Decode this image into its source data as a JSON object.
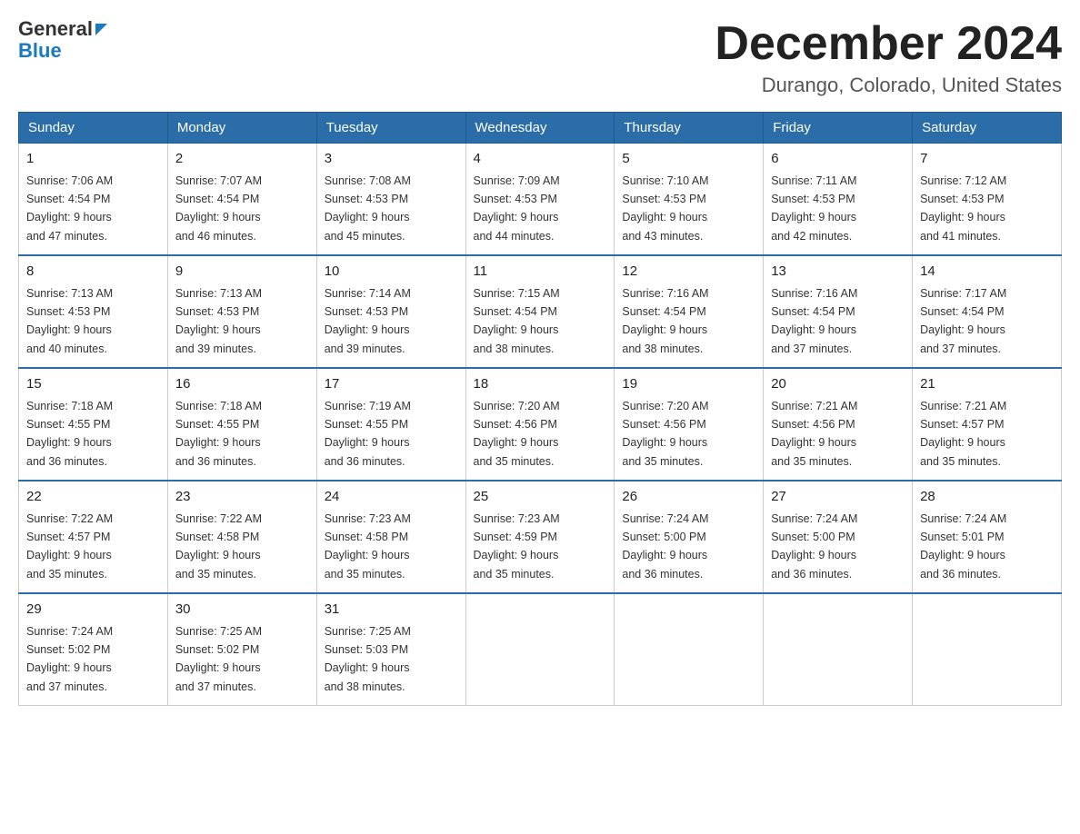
{
  "header": {
    "logo_general": "General",
    "logo_blue": "Blue",
    "month_title": "December 2024",
    "location": "Durango, Colorado, United States"
  },
  "days_of_week": [
    "Sunday",
    "Monday",
    "Tuesday",
    "Wednesday",
    "Thursday",
    "Friday",
    "Saturday"
  ],
  "weeks": [
    [
      {
        "day": "1",
        "sunrise": "7:06 AM",
        "sunset": "4:54 PM",
        "daylight": "9 hours and 47 minutes."
      },
      {
        "day": "2",
        "sunrise": "7:07 AM",
        "sunset": "4:54 PM",
        "daylight": "9 hours and 46 minutes."
      },
      {
        "day": "3",
        "sunrise": "7:08 AM",
        "sunset": "4:53 PM",
        "daylight": "9 hours and 45 minutes."
      },
      {
        "day": "4",
        "sunrise": "7:09 AM",
        "sunset": "4:53 PM",
        "daylight": "9 hours and 44 minutes."
      },
      {
        "day": "5",
        "sunrise": "7:10 AM",
        "sunset": "4:53 PM",
        "daylight": "9 hours and 43 minutes."
      },
      {
        "day": "6",
        "sunrise": "7:11 AM",
        "sunset": "4:53 PM",
        "daylight": "9 hours and 42 minutes."
      },
      {
        "day": "7",
        "sunrise": "7:12 AM",
        "sunset": "4:53 PM",
        "daylight": "9 hours and 41 minutes."
      }
    ],
    [
      {
        "day": "8",
        "sunrise": "7:13 AM",
        "sunset": "4:53 PM",
        "daylight": "9 hours and 40 minutes."
      },
      {
        "day": "9",
        "sunrise": "7:13 AM",
        "sunset": "4:53 PM",
        "daylight": "9 hours and 39 minutes."
      },
      {
        "day": "10",
        "sunrise": "7:14 AM",
        "sunset": "4:53 PM",
        "daylight": "9 hours and 39 minutes."
      },
      {
        "day": "11",
        "sunrise": "7:15 AM",
        "sunset": "4:54 PM",
        "daylight": "9 hours and 38 minutes."
      },
      {
        "day": "12",
        "sunrise": "7:16 AM",
        "sunset": "4:54 PM",
        "daylight": "9 hours and 38 minutes."
      },
      {
        "day": "13",
        "sunrise": "7:16 AM",
        "sunset": "4:54 PM",
        "daylight": "9 hours and 37 minutes."
      },
      {
        "day": "14",
        "sunrise": "7:17 AM",
        "sunset": "4:54 PM",
        "daylight": "9 hours and 37 minutes."
      }
    ],
    [
      {
        "day": "15",
        "sunrise": "7:18 AM",
        "sunset": "4:55 PM",
        "daylight": "9 hours and 36 minutes."
      },
      {
        "day": "16",
        "sunrise": "7:18 AM",
        "sunset": "4:55 PM",
        "daylight": "9 hours and 36 minutes."
      },
      {
        "day": "17",
        "sunrise": "7:19 AM",
        "sunset": "4:55 PM",
        "daylight": "9 hours and 36 minutes."
      },
      {
        "day": "18",
        "sunrise": "7:20 AM",
        "sunset": "4:56 PM",
        "daylight": "9 hours and 35 minutes."
      },
      {
        "day": "19",
        "sunrise": "7:20 AM",
        "sunset": "4:56 PM",
        "daylight": "9 hours and 35 minutes."
      },
      {
        "day": "20",
        "sunrise": "7:21 AM",
        "sunset": "4:56 PM",
        "daylight": "9 hours and 35 minutes."
      },
      {
        "day": "21",
        "sunrise": "7:21 AM",
        "sunset": "4:57 PM",
        "daylight": "9 hours and 35 minutes."
      }
    ],
    [
      {
        "day": "22",
        "sunrise": "7:22 AM",
        "sunset": "4:57 PM",
        "daylight": "9 hours and 35 minutes."
      },
      {
        "day": "23",
        "sunrise": "7:22 AM",
        "sunset": "4:58 PM",
        "daylight": "9 hours and 35 minutes."
      },
      {
        "day": "24",
        "sunrise": "7:23 AM",
        "sunset": "4:58 PM",
        "daylight": "9 hours and 35 minutes."
      },
      {
        "day": "25",
        "sunrise": "7:23 AM",
        "sunset": "4:59 PM",
        "daylight": "9 hours and 35 minutes."
      },
      {
        "day": "26",
        "sunrise": "7:24 AM",
        "sunset": "5:00 PM",
        "daylight": "9 hours and 36 minutes."
      },
      {
        "day": "27",
        "sunrise": "7:24 AM",
        "sunset": "5:00 PM",
        "daylight": "9 hours and 36 minutes."
      },
      {
        "day": "28",
        "sunrise": "7:24 AM",
        "sunset": "5:01 PM",
        "daylight": "9 hours and 36 minutes."
      }
    ],
    [
      {
        "day": "29",
        "sunrise": "7:24 AM",
        "sunset": "5:02 PM",
        "daylight": "9 hours and 37 minutes."
      },
      {
        "day": "30",
        "sunrise": "7:25 AM",
        "sunset": "5:02 PM",
        "daylight": "9 hours and 37 minutes."
      },
      {
        "day": "31",
        "sunrise": "7:25 AM",
        "sunset": "5:03 PM",
        "daylight": "9 hours and 38 minutes."
      },
      null,
      null,
      null,
      null
    ]
  ],
  "labels": {
    "sunrise": "Sunrise:",
    "sunset": "Sunset:",
    "daylight": "Daylight:"
  }
}
